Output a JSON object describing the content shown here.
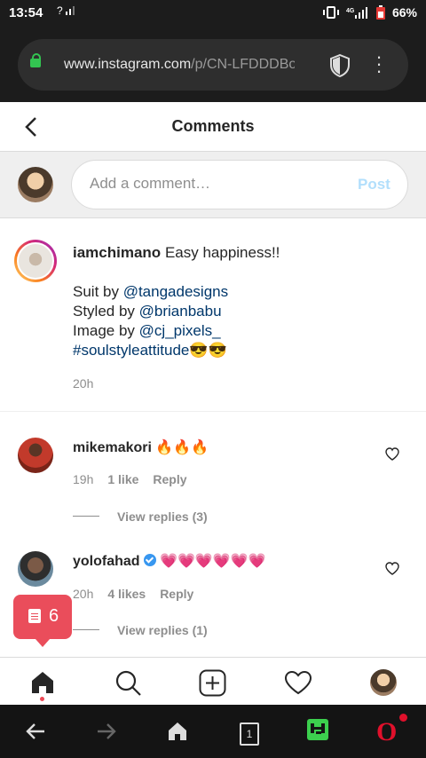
{
  "status_bar": {
    "time": "13:54",
    "signal_left": "?",
    "battery": "66%"
  },
  "browser": {
    "url_main": "www.instagram.com",
    "url_path": "/p/CN-LFDDDBoi/com"
  },
  "header": {
    "title": "Comments"
  },
  "comment_input": {
    "placeholder": "Add a comment…",
    "post_label": "Post"
  },
  "caption": {
    "username": "iamchimano",
    "text": "Easy happiness!!",
    "lines": [
      {
        "prefix": "Suit by ",
        "link": "@tangadesigns"
      },
      {
        "prefix": "Styled by ",
        "link": "@brianbabu"
      },
      {
        "prefix": "Image by ",
        "link": "@cj_pixels_"
      }
    ],
    "hashtag": "#soulstyleattitude",
    "emoji": "😎😎",
    "time": "20h"
  },
  "comments": [
    {
      "username": "mikemakori",
      "text": "🔥🔥🔥",
      "time": "19h",
      "likes": "1 like",
      "reply": "Reply",
      "view_replies": "View replies (3)",
      "verified": false
    },
    {
      "username": "yolofahad",
      "text": "💗💗💗💗💗💗",
      "time": "20h",
      "likes": "4 likes",
      "reply": "Reply",
      "view_replies": "View replies (1)",
      "verified": true
    }
  ],
  "floating_badge": {
    "count": "6"
  },
  "system_nav": {
    "tab_count": "1"
  },
  "colors": {
    "accent_link": "#00376b",
    "post_disabled": "#b2dffc",
    "badge": "#ea4d5b",
    "notification_dot": "#ed4956"
  }
}
